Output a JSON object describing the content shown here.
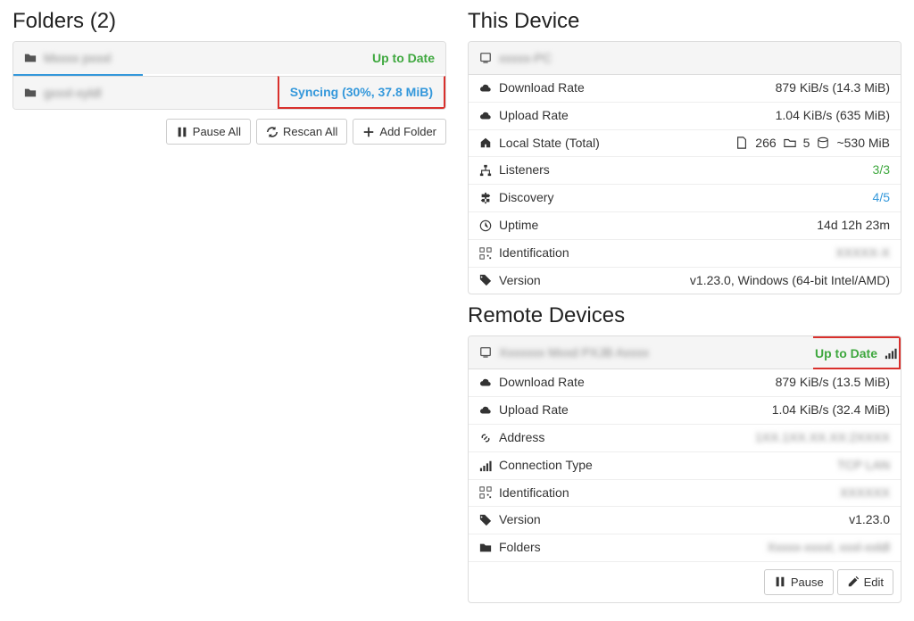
{
  "folders": {
    "heading_prefix": "Folders (",
    "heading_suffix": ")",
    "count": "2",
    "items": [
      {
        "name": "Mxxxx pxxxl",
        "status": "Up to Date",
        "status_class": "green"
      },
      {
        "name": "gxxxl-xyldl",
        "status": "Syncing (30%, 37.8 MiB)",
        "status_class": "blue-link",
        "progress": 30,
        "highlight": true
      }
    ],
    "buttons": {
      "pause_all": "Pause All",
      "rescan_all": "Rescan All",
      "add_folder": "Add Folder"
    }
  },
  "this_device": {
    "heading": "This Device",
    "name": "xxxxx-PC",
    "rows": {
      "download_rate_label": "Download Rate",
      "download_rate_value": "879 KiB/s (14.3 MiB)",
      "upload_rate_label": "Upload Rate",
      "upload_rate_value": "1.04 KiB/s (635 MiB)",
      "local_state_label": "Local State (Total)",
      "local_state_files": "266",
      "local_state_folders": "5",
      "local_state_size": "~530 MiB",
      "listeners_label": "Listeners",
      "listeners_value": "3/3",
      "discovery_label": "Discovery",
      "discovery_value": "4/5",
      "uptime_label": "Uptime",
      "uptime_value": "14d 12h 23m",
      "identification_label": "Identification",
      "identification_value": "XXXXX-X",
      "version_label": "Version",
      "version_value": "v1.23.0, Windows (64-bit Intel/AMD)"
    }
  },
  "remote_devices": {
    "heading": "Remote Devices",
    "device": {
      "name": "Xxxxxxx Mxxd PXJB Axxxx",
      "status": "Up to Date",
      "rows": {
        "download_rate_label": "Download Rate",
        "download_rate_value": "879 KiB/s (13.5 MiB)",
        "upload_rate_label": "Upload Rate",
        "upload_rate_value": "1.04 KiB/s (32.4 MiB)",
        "address_label": "Address",
        "address_value": "1XX.1XX.XX.XX:2XXXX",
        "connection_type_label": "Connection Type",
        "connection_type_value": "TCP LAN",
        "identification_label": "Identification",
        "identification_value": "XXXXXX",
        "version_label": "Version",
        "version_value": "v1.23.0",
        "folders_label": "Folders",
        "folders_value": "Xxxxx-xxxxl, xxxl-xxldl"
      },
      "buttons": {
        "pause": "Pause",
        "edit": "Edit"
      }
    }
  }
}
